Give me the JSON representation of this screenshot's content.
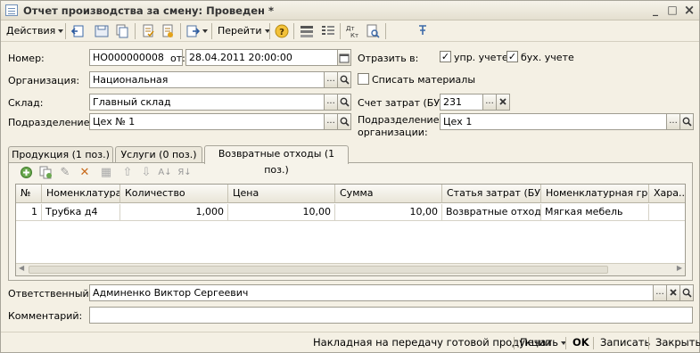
{
  "window": {
    "title": "Отчет производства за смену: Проведен *",
    "minimize": "_",
    "maximize": "□",
    "close": "×"
  },
  "toolbar": {
    "actions_label": "Действия",
    "goto_label": "Перейти"
  },
  "form": {
    "number_label": "Номер:",
    "number_value": "НО000000008",
    "from_label": "от:",
    "date_value": "28.04.2011 20:00:00",
    "reflect_label": "Отразить в:",
    "mgmt_label": "упр. учете",
    "mgmt_checked": true,
    "acc_label": "бух. учете",
    "acc_checked": true,
    "org_label": "Организация:",
    "org_value": "Национальная",
    "writeoff_label": "Списать материалы",
    "writeoff_checked": false,
    "warehouse_label": "Склад:",
    "warehouse_value": "Главный склад",
    "account_label": "Счет затрат (БУ):",
    "account_value": "231",
    "division_label": "Подразделение:",
    "division_value": "Цех № 1",
    "org_division_label_1": "Подразделение",
    "org_division_label_2": "организации:",
    "org_division_value": "Цех 1"
  },
  "tabs": [
    {
      "label": "Продукция (1 поз.)"
    },
    {
      "label": "Услуги (0 поз.)"
    },
    {
      "label": "Возвратные отходы (1 поз.)"
    }
  ],
  "grid": {
    "headers": [
      "№",
      "Номенклатура",
      "Количество",
      "Цена",
      "Сумма",
      "Статья затрат (БУ)",
      "Номенклатурная гр...",
      "Хара..."
    ],
    "rows": [
      {
        "n": "1",
        "item": "Трубка д4",
        "qty": "1,000",
        "price": "10,00",
        "sum": "10,00",
        "cost_item": "Возвратные отходы",
        "group": "Мягкая мебель",
        "char": ""
      }
    ]
  },
  "footer": {
    "responsible_label": "Ответственный:",
    "responsible_value": "Админенко Виктор Сергеевич",
    "comment_label": "Комментарий:",
    "comment_value": ""
  },
  "bottom": {
    "invoice_label": "Накладная на передачу готовой продукции",
    "print_label": "Печать",
    "ok_label": "OK",
    "save_label": "Записать",
    "close_label": "Закрыть"
  }
}
